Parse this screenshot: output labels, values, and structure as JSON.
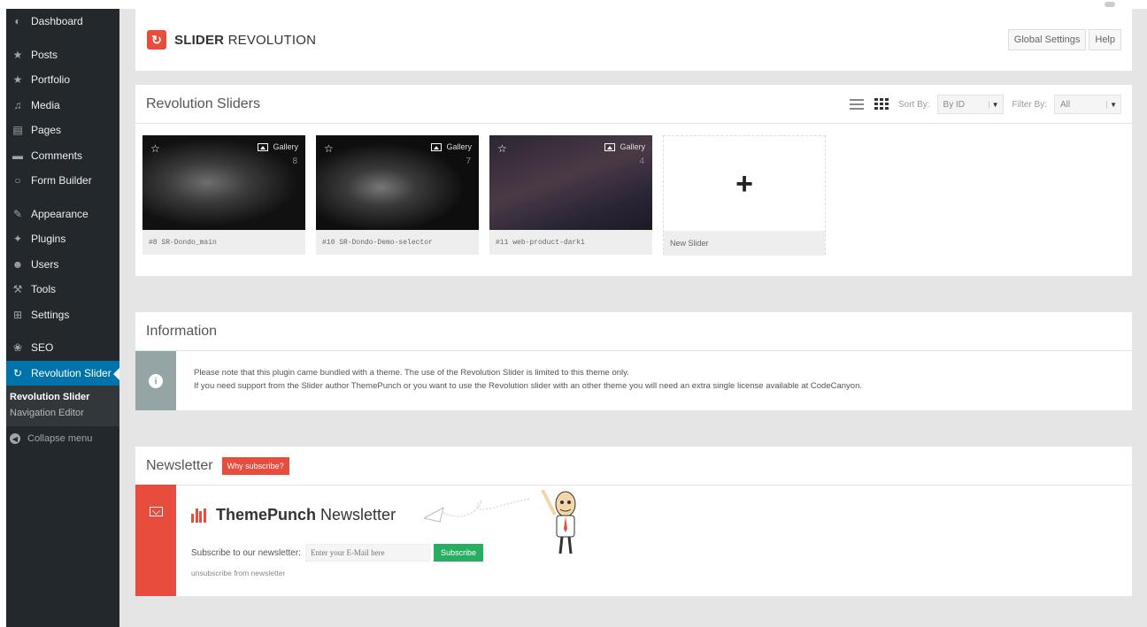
{
  "sidebar": {
    "items": [
      {
        "label": "Dashboard",
        "icon": "dashboard-icon",
        "glyph": "◐"
      },
      {
        "label": "Posts",
        "icon": "pin-icon",
        "glyph": "★"
      },
      {
        "label": "Portfolio",
        "icon": "pin-icon",
        "glyph": "★"
      },
      {
        "label": "Media",
        "icon": "media-icon",
        "glyph": "♫"
      },
      {
        "label": "Pages",
        "icon": "pages-icon",
        "glyph": "▤"
      },
      {
        "label": "Comments",
        "icon": "comments-icon",
        "glyph": "▬"
      },
      {
        "label": "Form Builder",
        "icon": "form-icon",
        "glyph": "○"
      },
      {
        "label": "Appearance",
        "icon": "brush-icon",
        "glyph": "✎"
      },
      {
        "label": "Plugins",
        "icon": "plug-icon",
        "glyph": "✦"
      },
      {
        "label": "Users",
        "icon": "users-icon",
        "glyph": "☻"
      },
      {
        "label": "Tools",
        "icon": "wrench-icon",
        "glyph": "⚒"
      },
      {
        "label": "Settings",
        "icon": "settings-icon",
        "glyph": "⊞"
      },
      {
        "label": "SEO",
        "icon": "seo-icon",
        "glyph": "❀"
      },
      {
        "label": "Revolution Slider",
        "icon": "refresh-icon",
        "glyph": "↻"
      }
    ],
    "submenu": [
      "Revolution Slider",
      "Navigation Editor"
    ],
    "collapse_label": "Collapse menu"
  },
  "header": {
    "logo_bold": "SLIDER",
    "logo_rest": " REVOLUTION",
    "logo_glyph": "↻",
    "global_settings": "Global Settings",
    "help": "Help"
  },
  "sliders_panel": {
    "title": "Revolution Sliders",
    "sort_label": "Sort By:",
    "sort_value": "By ID",
    "filter_label": "Filter By:",
    "filter_value": "All",
    "sliders": [
      {
        "label": "#8  SR-Dondo_main",
        "type": "Gallery",
        "count": "8"
      },
      {
        "label": "#10  SR-Dondo-Demo-selector",
        "type": "Gallery",
        "count": "7"
      },
      {
        "label": "#11  web-product-dark1",
        "type": "Gallery",
        "count": "4"
      }
    ],
    "new_slider_label": "New Slider",
    "star_glyph": "☆",
    "plus_glyph": "+"
  },
  "info_panel": {
    "title": "Information",
    "icon_glyph": "i",
    "line1": "Please note that this plugin came bundled with a theme. The use of the Revolution Slider is limited to this theme only.",
    "line2": "If you need support from the Slider author ThemePunch or you want to use the Revolution slider with an other theme you will need an extra single license available at CodeCanyon."
  },
  "newsletter_panel": {
    "title": "Newsletter",
    "why_label": "Why subscribe?",
    "brand_bold": "ThemePunch",
    "brand_rest": "Newsletter",
    "subscribe_label": "Subscribe to our newsletter:",
    "email_placeholder": "Enter your E-Mail here",
    "subscribe_button": "Subscribe",
    "unsubscribe_link": "unsubscribe from newsletter"
  },
  "colors": {
    "sidebar_bg": "#23282d",
    "active_blue": "#0073aa",
    "accent_red": "#e74c3c",
    "info_gray": "#95a5a6",
    "subscribe_green": "#27ae60"
  }
}
